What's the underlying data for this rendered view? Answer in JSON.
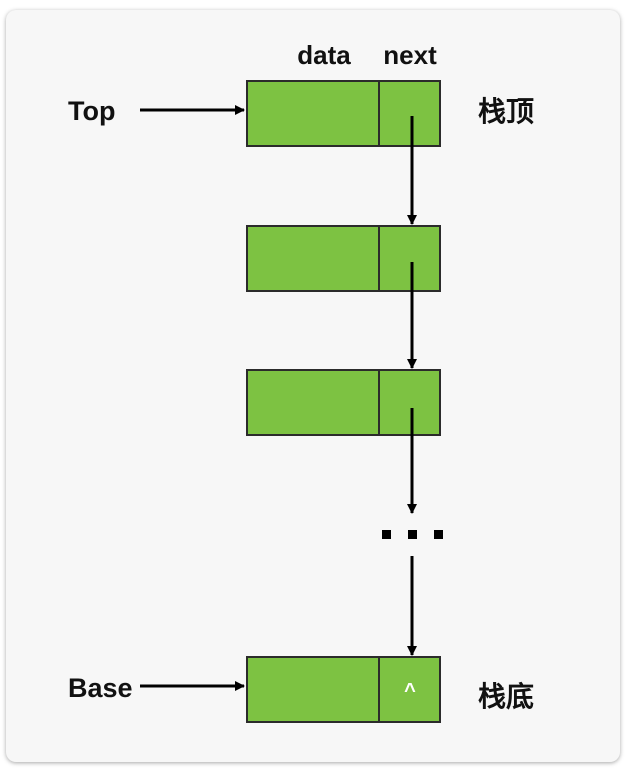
{
  "header": {
    "data_label": "data",
    "next_label": "next"
  },
  "pointers": {
    "top_label": "Top",
    "base_label": "Base"
  },
  "annotations": {
    "stack_top": "栈顶",
    "stack_bottom": "栈底"
  },
  "ellipsis": "...",
  "null_marker": "^",
  "colors": {
    "node_fill": "#7dc242",
    "node_stroke": "#2b2b2b",
    "arrow": "#000000",
    "panel": "#f7f7f7"
  }
}
